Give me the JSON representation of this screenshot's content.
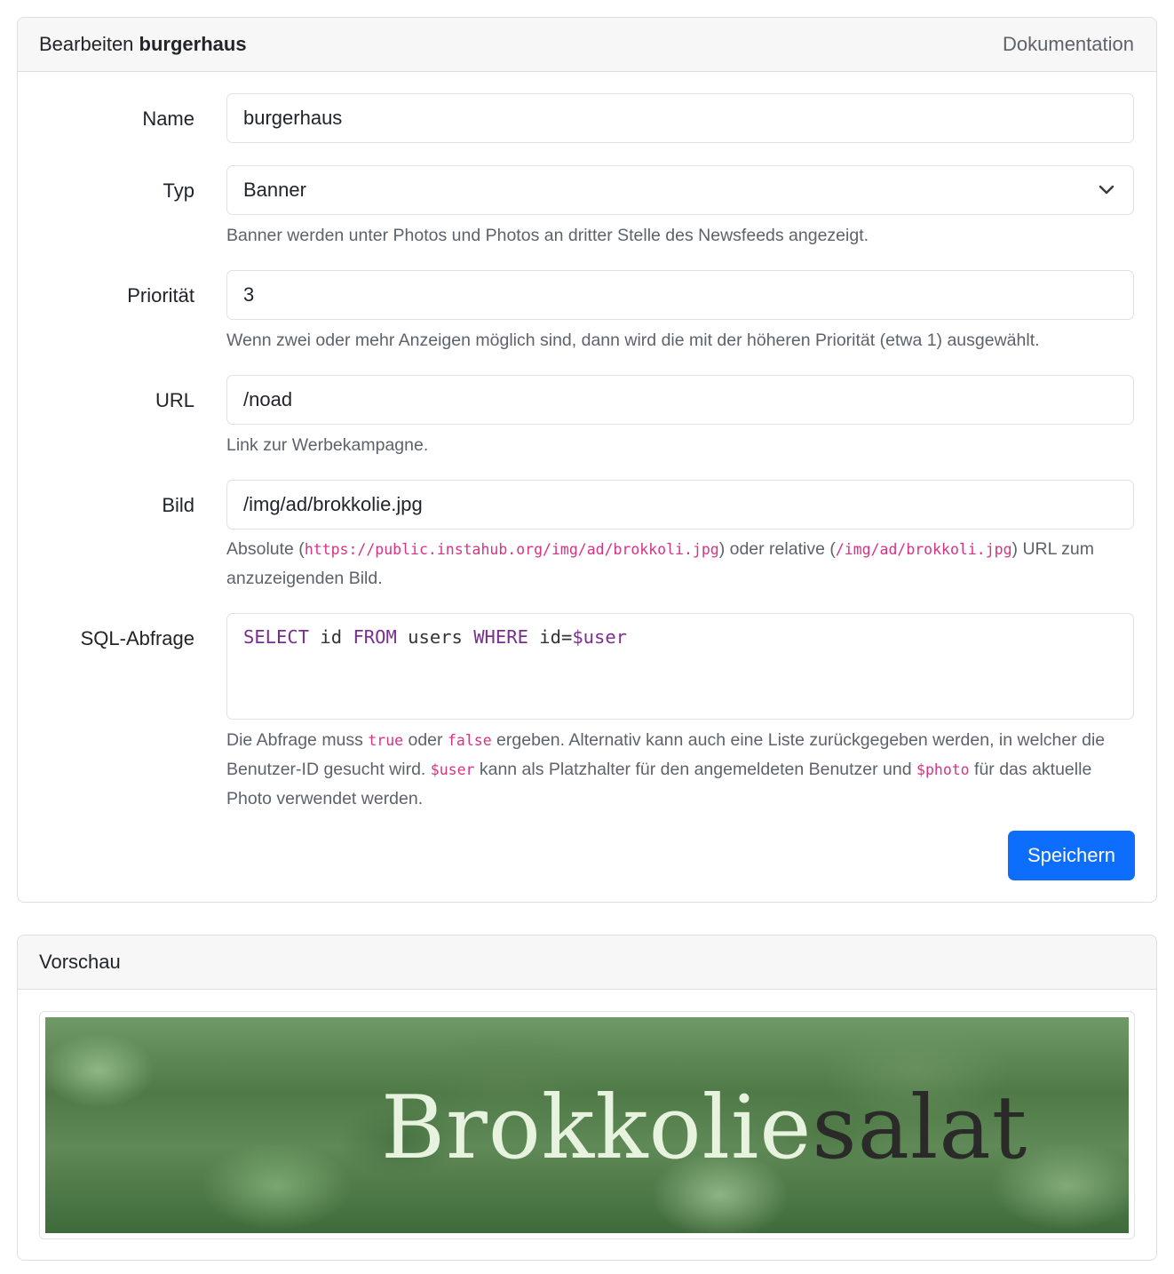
{
  "header": {
    "title_prefix": "Bearbeiten",
    "title_name": "burgerhaus",
    "doc_link": "Dokumentation"
  },
  "form": {
    "name": {
      "label": "Name",
      "value": "burgerhaus"
    },
    "typ": {
      "label": "Typ",
      "value": "Banner",
      "help": "Banner werden unter Photos und Photos an dritter Stelle des Newsfeeds angezeigt."
    },
    "prio": {
      "label": "Priorität",
      "value": "3",
      "help": "Wenn zwei oder mehr Anzeigen möglich sind, dann wird die mit der höheren Priorität (etwa 1) ausgewählt."
    },
    "url": {
      "label": "URL",
      "value": "/noad",
      "help": "Link zur Werbekampagne."
    },
    "bild": {
      "label": "Bild",
      "value": "/img/ad/brokkolie.jpg",
      "help_absolute": "Absolute (",
      "help_abs_code": "https://public.instahub.org/img/ad/brokkoli.jpg",
      "help_middle": ") oder relative (",
      "help_rel_code": "/img/ad/brokkoli.jpg",
      "help_end": ") URL zum anzuzeigenden Bild."
    },
    "sql": {
      "label": "SQL-Abfrage",
      "kw_select": "SELECT",
      "t_id": " id ",
      "kw_from": "FROM",
      "t_users": " users ",
      "kw_where": "WHERE",
      "t_cond": " id=",
      "t_var": "$user",
      "help_1": "Die Abfrage muss ",
      "code_true": "true",
      "help_2": " oder ",
      "code_false": "false",
      "help_3": " ergeben. Alternativ kann auch eine Liste zurückgegeben werden, in welcher die Benutzer-ID gesucht wird. ",
      "code_user": "$user",
      "help_4": " kann als Platzhalter für den angemeldeten Benutzer und ",
      "code_photo": "$photo",
      "help_5": " für das aktuelle Photo verwendet werden."
    },
    "save_label": "Speichern"
  },
  "preview": {
    "title": "Vorschau",
    "banner_light": "Brokkolie",
    "banner_dark": "salat"
  }
}
